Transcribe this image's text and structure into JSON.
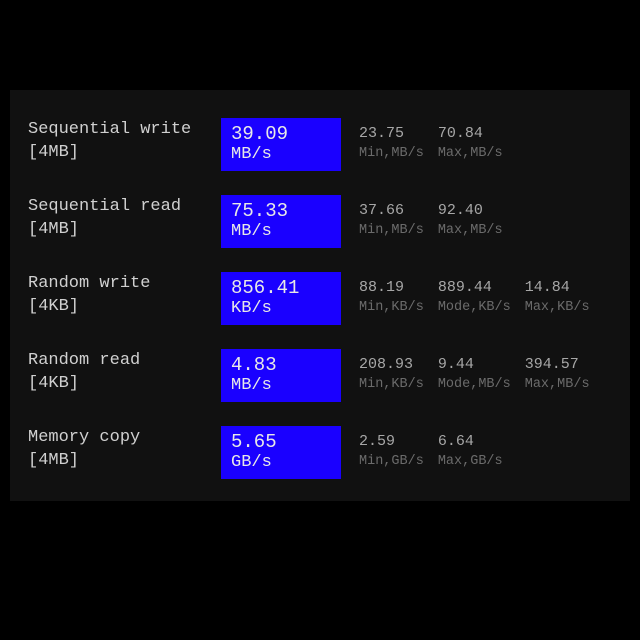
{
  "rows": [
    {
      "name": "Sequential write\n[4MB]",
      "value": "39.09",
      "unit": "MB/s",
      "stats": [
        {
          "v": "23.75",
          "l": "Min,MB/s"
        },
        {
          "v": "70.84",
          "l": "Max,MB/s"
        }
      ]
    },
    {
      "name": "Sequential read\n[4MB]",
      "value": "75.33",
      "unit": "MB/s",
      "stats": [
        {
          "v": "37.66",
          "l": "Min,MB/s"
        },
        {
          "v": "92.40",
          "l": "Max,MB/s"
        }
      ]
    },
    {
      "name": "Random write\n[4KB]",
      "value": "856.41",
      "unit": "KB/s",
      "stats": [
        {
          "v": "88.19",
          "l": "Min,KB/s"
        },
        {
          "v": "889.44",
          "l": "Mode,KB/s"
        },
        {
          "v": "14.84",
          "l": "Max,KB/s"
        }
      ]
    },
    {
      "name": "Random read\n[4KB]",
      "value": "4.83",
      "unit": "MB/s",
      "stats": [
        {
          "v": "208.93",
          "l": "Min,KB/s"
        },
        {
          "v": "9.44",
          "l": "Mode,MB/s"
        },
        {
          "v": "394.57",
          "l": "Max,MB/s"
        }
      ]
    },
    {
      "name": "Memory copy\n[4MB]",
      "value": "5.65",
      "unit": "GB/s",
      "stats": [
        {
          "v": "2.59",
          "l": "Min,GB/s"
        },
        {
          "v": "6.64",
          "l": "Max,GB/s"
        }
      ]
    }
  ]
}
